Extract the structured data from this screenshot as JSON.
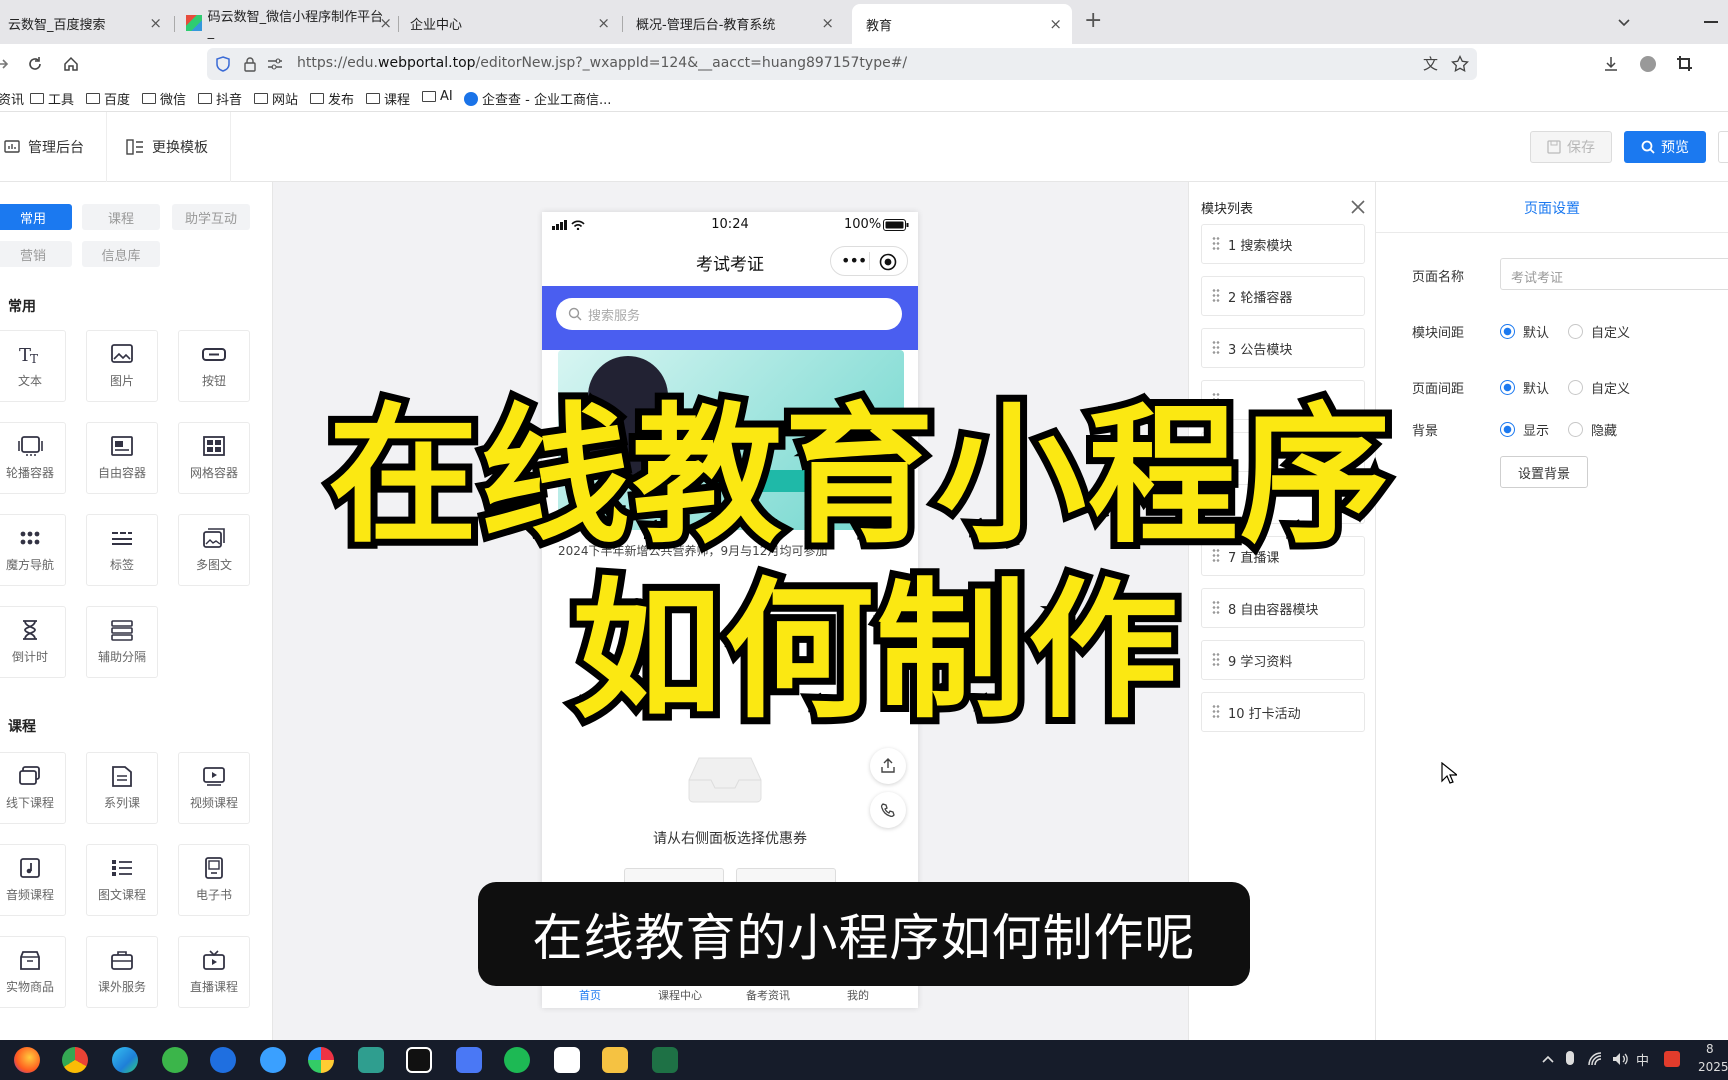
{
  "browser": {
    "tabs": [
      {
        "label": "云数智_百度搜索"
      },
      {
        "label": "码云数智_微信小程序制作平台_"
      },
      {
        "label": "企业中心"
      },
      {
        "label": "概况-管理后台-教育系统"
      },
      {
        "label": "教育"
      }
    ],
    "tab_close": "×",
    "new_tab": "+",
    "url_prefix": "https://edu.",
    "url_host": "webportal.top",
    "url_path": "/editorNew.jsp?_wxappId=124&__aacct=huang897157type#/",
    "bookmarks": [
      "资讯",
      "工具",
      "百度",
      "微信",
      "抖音",
      "网站",
      "发布",
      "课程",
      "AI",
      "企查查 - 企业工商信..."
    ]
  },
  "header": {
    "admin_label": "管理后台",
    "template_label": "更换模板",
    "save_label": "保存",
    "preview_label": "预览"
  },
  "left": {
    "categories": [
      "常用",
      "课程",
      "助学互动",
      "营销",
      "信息库"
    ],
    "section_common": "常用",
    "section_course": "课程",
    "common_items": [
      "文本",
      "图片",
      "按钮",
      "轮播容器",
      "自由容器",
      "网格容器",
      "魔方导航",
      "标签",
      "多图文",
      "倒计时",
      "辅助分隔"
    ],
    "course_items": [
      "线下课程",
      "系列课",
      "视频课程",
      "音频课程",
      "图文课程",
      "电子书",
      "实物商品",
      "课外服务",
      "直播课程"
    ]
  },
  "phone": {
    "time": "10:24",
    "battery": "100%",
    "title": "考试考证",
    "search_placeholder": "搜索服务",
    "notice": "2024下半年新增公共营养师，9月与12月均可参加",
    "coupon_hint": "请从右侧面板选择优惠券",
    "nav": [
      "首页",
      "课程中心",
      "备考资讯",
      "我的"
    ]
  },
  "modules": {
    "title": "模块列表",
    "items": [
      "1 搜索模块",
      "2 轮播容器",
      "3 公告模块",
      "7 直播课",
      "8 自由容器模块",
      "9 学习资料",
      "10 打卡活动"
    ]
  },
  "settings": {
    "tab": "页面设置",
    "name_label": "页面名称",
    "name_value": "考试考证",
    "spacing_label": "模块间距",
    "margin_label": "页面间距",
    "bg_label": "背景",
    "opt_default": "默认",
    "opt_custom": "自定义",
    "opt_show": "显示",
    "opt_hide": "隐藏",
    "bg_button": "设置背景"
  },
  "overlay": {
    "line1": "在线教育小程序",
    "line2": "如何制作",
    "subtitle": "在线教育的小程序如何制作呢"
  },
  "taskbar": {
    "ime": "中",
    "clock_top": "8",
    "clock_bottom": "2025"
  },
  "colors": {
    "accent": "#1b79f0",
    "overlay_yellow": "#fbe812",
    "search_band": "#4a5ef0"
  }
}
